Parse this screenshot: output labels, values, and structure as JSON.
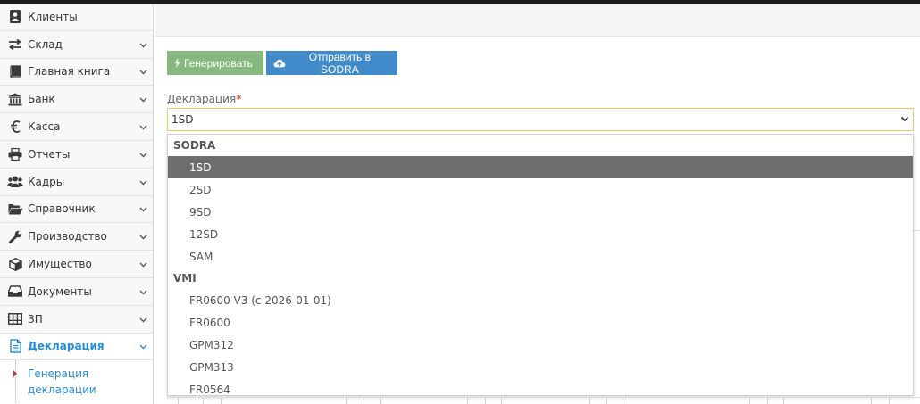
{
  "sidebar": {
    "items": [
      {
        "label": "Клиенты",
        "icon": "address-book-icon",
        "has_children": false,
        "active": false
      },
      {
        "label": "Склад",
        "icon": "exchange-icon",
        "has_children": true,
        "active": false
      },
      {
        "label": "Главная книга",
        "icon": "book-icon",
        "has_children": true,
        "active": false
      },
      {
        "label": "Банк",
        "icon": "bank-icon",
        "has_children": true,
        "active": false
      },
      {
        "label": "Касса",
        "icon": "euro-icon",
        "has_children": true,
        "active": false
      },
      {
        "label": "Отчеты",
        "icon": "print-icon",
        "has_children": true,
        "active": false
      },
      {
        "label": "Кадры",
        "icon": "users-icon",
        "has_children": true,
        "active": false
      },
      {
        "label": "Справочник",
        "icon": "folder-open-icon",
        "has_children": true,
        "active": false
      },
      {
        "label": "Производство",
        "icon": "wrench-icon",
        "has_children": true,
        "active": false
      },
      {
        "label": "Имущество",
        "icon": "cube-icon",
        "has_children": true,
        "active": false
      },
      {
        "label": "Документы",
        "icon": "inbox-icon",
        "has_children": true,
        "active": false
      },
      {
        "label": "ЗП",
        "icon": "table-icon",
        "has_children": true,
        "active": false
      },
      {
        "label": "Декларация",
        "icon": "file-text-icon",
        "has_children": true,
        "active": true
      }
    ],
    "subitem": {
      "label": "Генерация декларации"
    }
  },
  "toolbar": {
    "generate_label": "Генерировать",
    "send_label": "Отправить в SODRA"
  },
  "form": {
    "declaration_label": "Декларация",
    "required_mark": "*",
    "selected_value": "1SD"
  },
  "dropdown": {
    "groups": [
      {
        "name": "SODRA",
        "options": [
          "1SD",
          "2SD",
          "9SD",
          "12SD",
          "SAM"
        ]
      },
      {
        "name": "VMI",
        "options": [
          "FR0600 V3 (с 2026-01-01)",
          "FR0600",
          "GPM312",
          "GPM313",
          "FR0564"
        ]
      }
    ],
    "highlighted": "1SD"
  },
  "colors": {
    "accent": "#2a8dd4",
    "green_button": "#87b87f",
    "blue_button": "#428bca",
    "select_border": "#f0c36d",
    "highlight": "#6e6e6e"
  }
}
